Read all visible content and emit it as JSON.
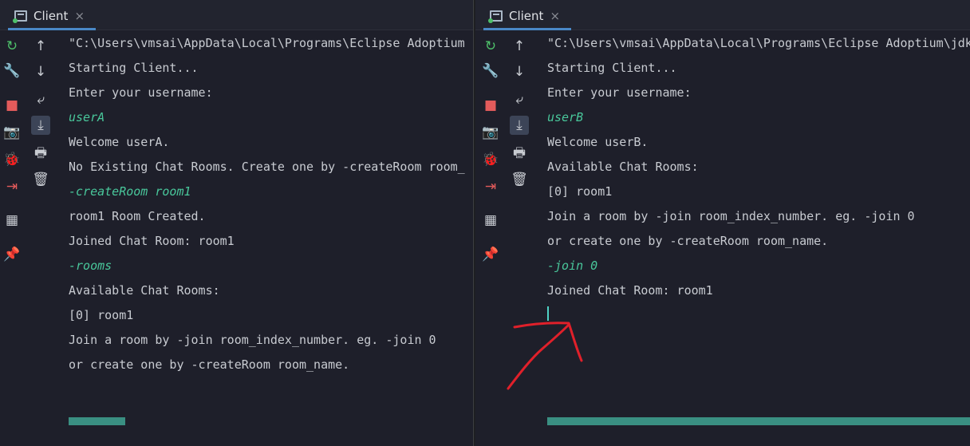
{
  "left_pane": {
    "tab": {
      "label": "Client",
      "close": "×"
    },
    "lines": [
      {
        "text": "\"C:\\Users\\vmsai\\AppData\\Local\\Programs\\Eclipse Adoptium",
        "kind": "output"
      },
      {
        "text": "Starting Client...",
        "kind": "output"
      },
      {
        "text": "Enter your username:",
        "kind": "output"
      },
      {
        "text": "userA",
        "kind": "input"
      },
      {
        "text": "Welcome userA.",
        "kind": "output"
      },
      {
        "text": "No Existing Chat Rooms. Create one by -createRoom room_",
        "kind": "output"
      },
      {
        "text": "-createRoom room1",
        "kind": "input"
      },
      {
        "text": "room1 Room Created.",
        "kind": "output"
      },
      {
        "text": "Joined Chat Room: room1",
        "kind": "output"
      },
      {
        "text": "-rooms",
        "kind": "input"
      },
      {
        "text": "Available Chat Rooms:",
        "kind": "output"
      },
      {
        "text": "[0] room1",
        "kind": "output"
      },
      {
        "text": "Join a room by -join room_index_number. eg. -join 0",
        "kind": "output"
      },
      {
        "text": "or create one by -createRoom room_name.",
        "kind": "output"
      }
    ]
  },
  "right_pane": {
    "tab": {
      "label": "Client",
      "close": "×"
    },
    "lines": [
      {
        "text": "\"C:\\Users\\vmsai\\AppData\\Local\\Programs\\Eclipse Adoptium\\jdk",
        "kind": "output"
      },
      {
        "text": "Starting Client...",
        "kind": "output"
      },
      {
        "text": "Enter your username:",
        "kind": "output"
      },
      {
        "text": "userB",
        "kind": "input"
      },
      {
        "text": "Welcome userB.",
        "kind": "output"
      },
      {
        "text": "Available Chat Rooms:",
        "kind": "output"
      },
      {
        "text": "[0] room1",
        "kind": "output"
      },
      {
        "text": "Join a room by -join room_index_number. eg. -join 0",
        "kind": "output"
      },
      {
        "text": "or create one by -createRoom room_name.",
        "kind": "output"
      },
      {
        "text": "-join 0",
        "kind": "input"
      },
      {
        "text": "Joined Chat Room: room1",
        "kind": "output"
      }
    ]
  },
  "icons": {
    "rerun": "↻",
    "settings": "🔧",
    "stop": "■",
    "screenshot": "📷",
    "debug": "🐞",
    "exit": "⇥",
    "layout": "▦",
    "pin": "📌",
    "up": "↑",
    "down": "↓",
    "soft_wrap": "⤶",
    "scroll_end": "⤓",
    "print": "🖶",
    "trash": "🗑"
  },
  "colors": {
    "output_text": "#c8cbd1",
    "input_text": "#49c79b",
    "annotation": "#e0202a"
  }
}
